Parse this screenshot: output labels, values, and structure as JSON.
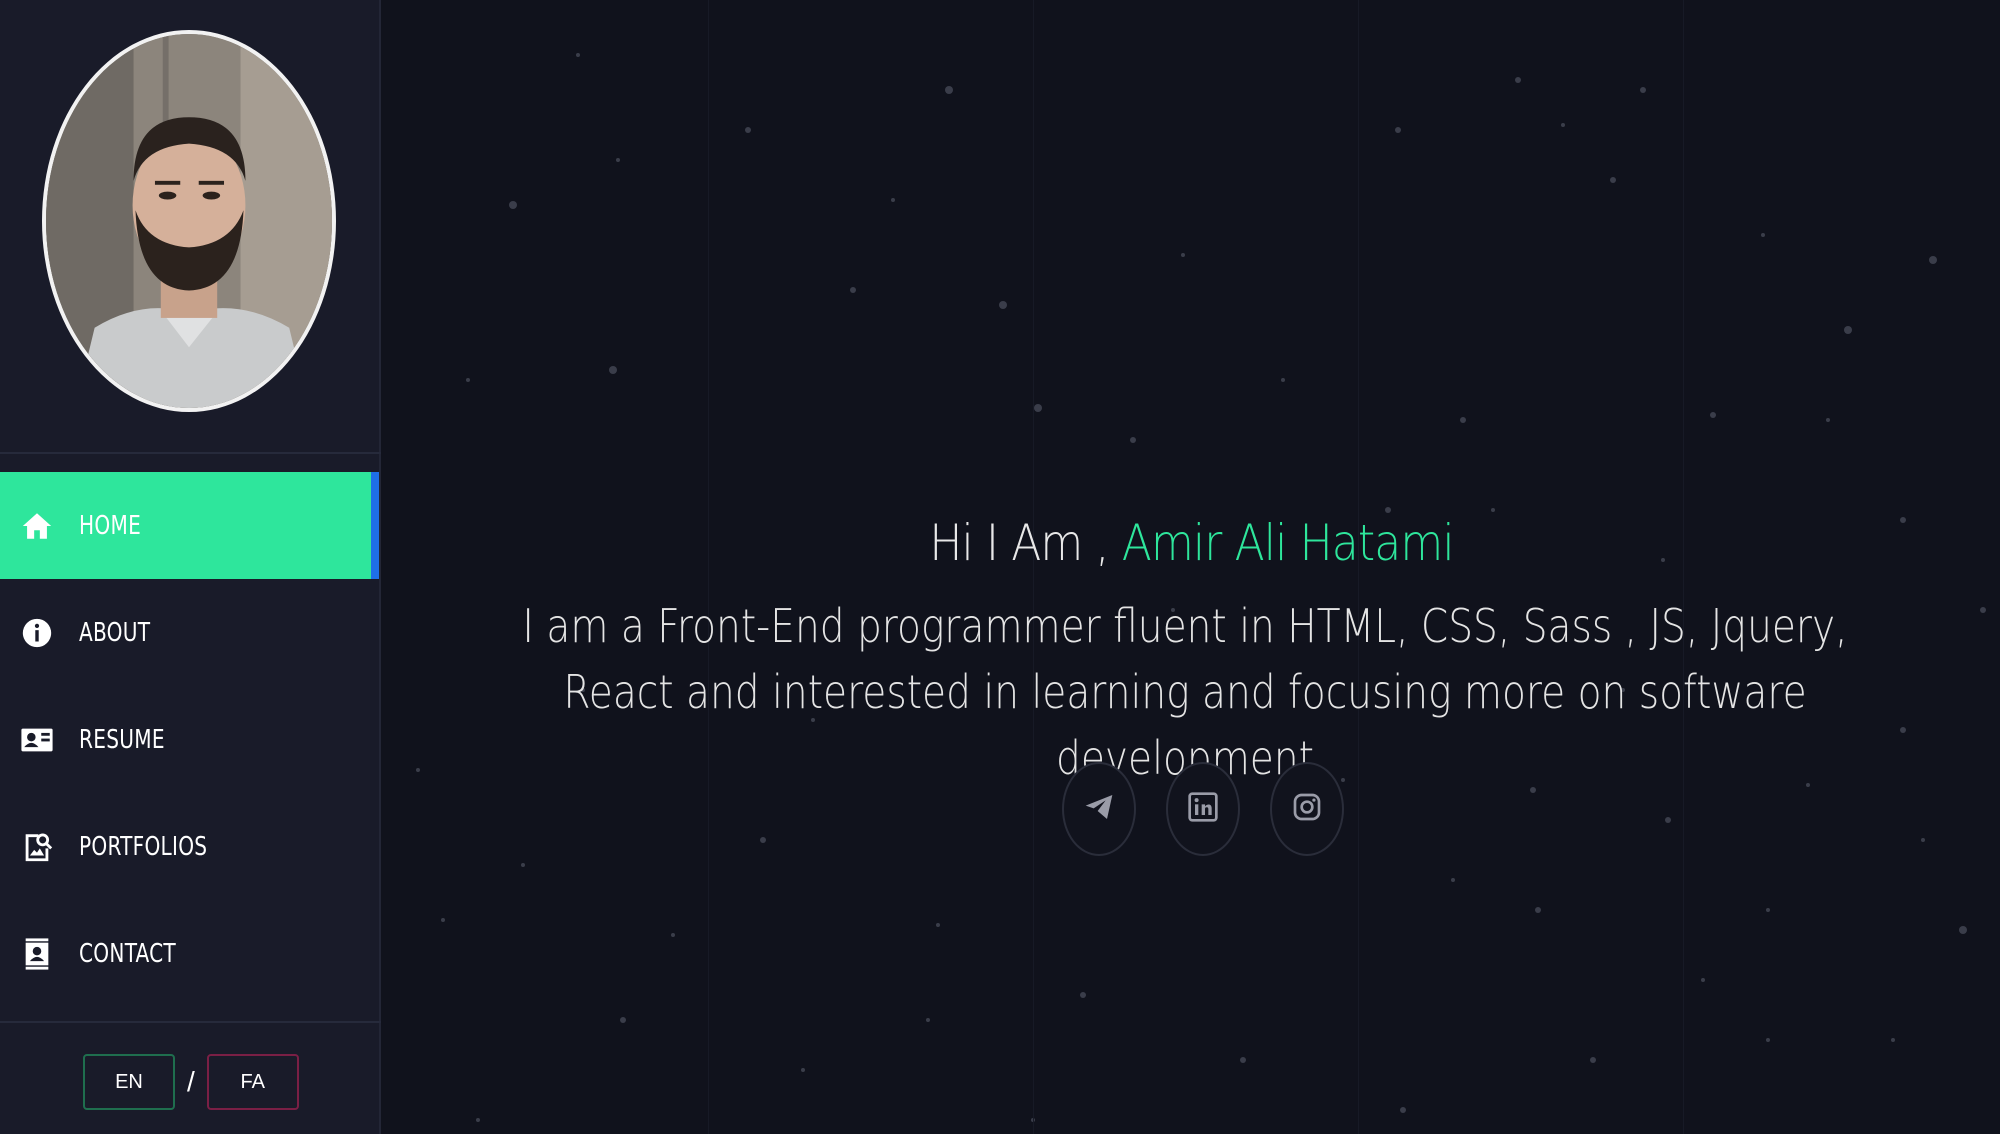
{
  "sidebar": {
    "nav": [
      {
        "label": "HOME",
        "icon": "home-icon",
        "active": true
      },
      {
        "label": "ABOUT",
        "icon": "info-icon",
        "active": false
      },
      {
        "label": "RESUME",
        "icon": "contact-card-icon",
        "active": false
      },
      {
        "label": "PORTFOLIOS",
        "icon": "image-search-icon",
        "active": false
      },
      {
        "label": "CONTACT",
        "icon": "contact-book-icon",
        "active": false
      }
    ],
    "lang": {
      "en": "EN",
      "separator": "/",
      "fa": "FA"
    }
  },
  "hero": {
    "greeting_prefix": "Hi I Am , ",
    "name": "Amir Ali Hatami",
    "tagline": "I am a Front-End programmer fluent in HTML, CSS, Sass , JS, Jquery, React and interested in learning and focusing more on software development"
  },
  "socials": [
    {
      "icon": "telegram-icon"
    },
    {
      "icon": "linkedin-icon"
    },
    {
      "icon": "instagram-icon"
    }
  ],
  "colors": {
    "accent": "#2ee69c",
    "active_marker": "#1e6fe8",
    "sidebar_bg": "#191b29",
    "page_bg": "#10121c"
  }
}
